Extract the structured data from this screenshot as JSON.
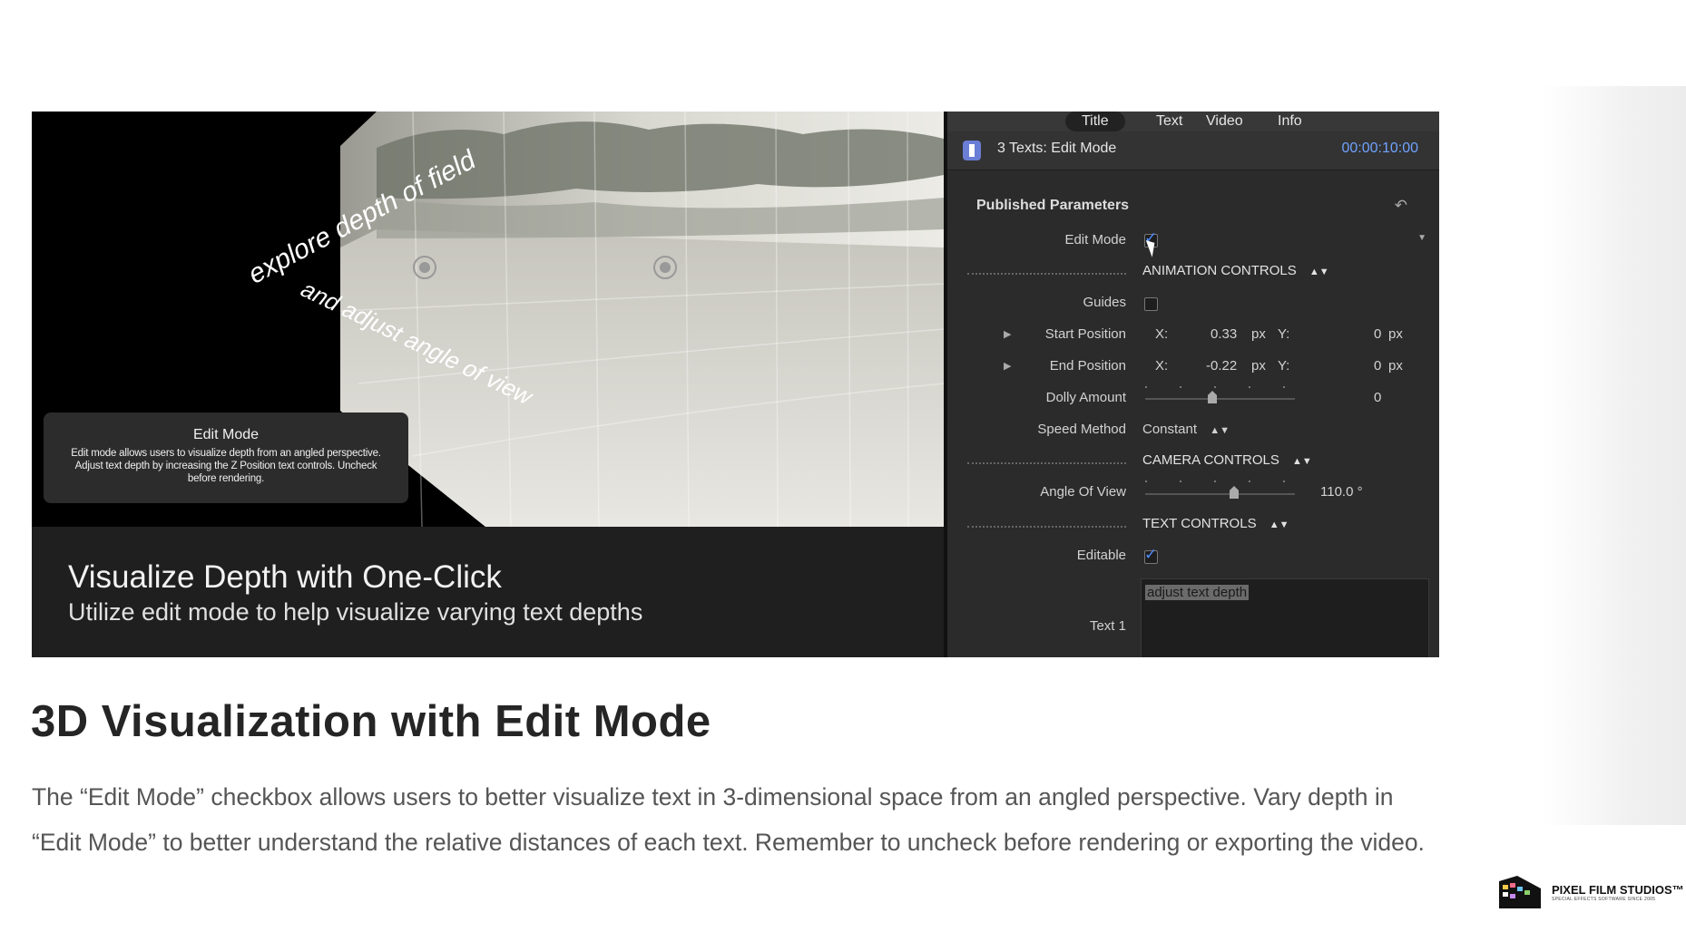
{
  "video_frame": {
    "scene_text_1": "explore depth of field",
    "scene_text_2": "and adjust angle of view",
    "edit_box": {
      "title": "Edit Mode",
      "body": "Edit mode allows users to visualize depth from an angled perspective.  Adjust text depth by increasing the Z Position text controls.  Uncheck before rendering."
    },
    "caption_title": "Visualize Depth with One-Click",
    "caption_subtitle": "Utilize edit mode to help visualize varying text depths"
  },
  "inspector": {
    "tabs": [
      "Title",
      "Text",
      "Video",
      "Info"
    ],
    "active_tab": "Title",
    "header_title": "3 Texts: Edit Mode",
    "timecode": "00:00:10:00",
    "published_parameters": "Published Parameters",
    "edit_mode_label": "Edit Mode",
    "animation_controls": "ANIMATION CONTROLS",
    "guides_label": "Guides",
    "start_position": {
      "label": "Start Position",
      "x_label": "X:",
      "x_value": "0.33",
      "x_unit": "px",
      "y_label": "Y:",
      "y_value": "0",
      "y_unit": "px"
    },
    "end_position": {
      "label": "End Position",
      "x_label": "X:",
      "x_value": "-0.22",
      "x_unit": "px",
      "y_label": "Y:",
      "y_value": "0",
      "y_unit": "px"
    },
    "dolly_amount": {
      "label": "Dolly Amount",
      "value": "0"
    },
    "speed_method": {
      "label": "Speed Method",
      "value": "Constant"
    },
    "camera_controls": "CAMERA CONTROLS",
    "angle_of_view": {
      "label": "Angle Of View",
      "value": "110.0 °"
    },
    "text_controls": "TEXT CONTROLS",
    "editable_label": "Editable",
    "text1": {
      "label": "Text 1",
      "value": "adjust text depth"
    },
    "check_color": "#4f8cff",
    "timecode_color": "#6fa2ff"
  },
  "article": {
    "heading": "3D Visualization with Edit Mode",
    "body": "The “Edit Mode” checkbox allows users to better visualize text in 3-dimensional space from an angled perspective.  Vary depth in “Edit Mode” to better understand the relative distances of each text. Remember to uncheck before rendering or exporting the video."
  },
  "logo": {
    "name": "PIXEL FILM STUDIOS™",
    "tagline": "SPECIAL EFFECTS SOFTWARE SINCE 2005"
  }
}
